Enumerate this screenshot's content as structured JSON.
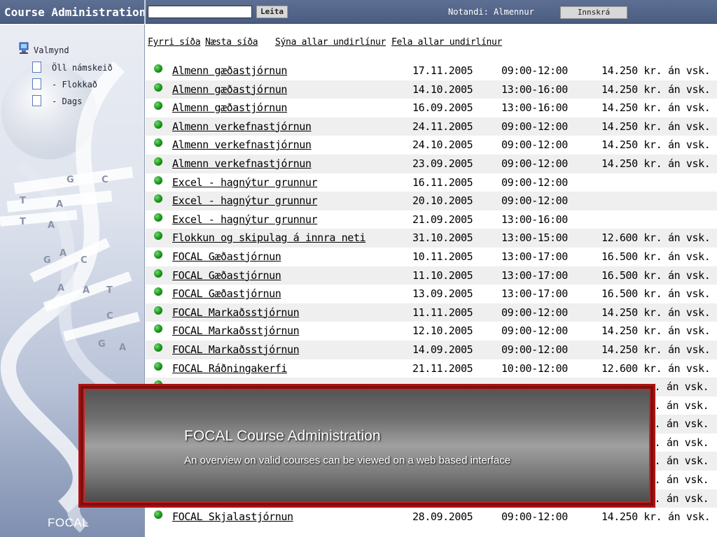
{
  "topbar": {
    "app_title": "Course Administration",
    "search_value": "",
    "search_button": "Leita",
    "user_label": "Notandi: Almennur",
    "login_button": "Innskrá"
  },
  "sidebar": {
    "root": "Valmynd",
    "items": [
      {
        "label": "Öll námskeið"
      },
      {
        "label": "- Flokkað"
      },
      {
        "label": "- Dags"
      }
    ],
    "footer": "FOCAL",
    "decoration_letters": [
      "G",
      "C",
      "T",
      "A",
      "T",
      "A",
      "A",
      "G",
      "C",
      "A",
      "A",
      "T",
      "C",
      "G",
      "A"
    ]
  },
  "nav": {
    "prev": "Fyrri síða",
    "next": "Næsta síða",
    "show_all": "Sýna allar undirlínur",
    "hide_all": "Fela allar undirlínur"
  },
  "courses": [
    {
      "name": "Almenn gæðastjórnun",
      "date": "17.11.2005",
      "time": "09:00-12:00",
      "price": "14.250 kr. án vsk."
    },
    {
      "name": "Almenn gæðastjórnun",
      "date": "14.10.2005",
      "time": "13:00-16:00",
      "price": "14.250 kr. án vsk."
    },
    {
      "name": "Almenn gæðastjórnun",
      "date": "16.09.2005",
      "time": "13:00-16:00",
      "price": "14.250 kr. án vsk."
    },
    {
      "name": "Almenn verkefnastjórnun",
      "date": "24.11.2005",
      "time": "09:00-12:00",
      "price": "14.250 kr. án vsk."
    },
    {
      "name": "Almenn verkefnastjórnun",
      "date": "24.10.2005",
      "time": "09:00-12:00",
      "price": "14.250 kr. án vsk."
    },
    {
      "name": "Almenn verkefnastjórnun",
      "date": "23.09.2005",
      "time": "09:00-12:00",
      "price": "14.250 kr. án vsk."
    },
    {
      "name": "Excel - hagnýtur grunnur",
      "date": "16.11.2005",
      "time": "09:00-12:00",
      "price": ""
    },
    {
      "name": "Excel - hagnýtur grunnur",
      "date": "20.10.2005",
      "time": "09:00-12:00",
      "price": ""
    },
    {
      "name": "Excel - hagnýtur grunnur",
      "date": "21.09.2005",
      "time": "13:00-16:00",
      "price": ""
    },
    {
      "name": "Flokkun og skipulag á innra neti",
      "date": "31.10.2005",
      "time": "13:00-15:00",
      "price": "12.600 kr. án vsk."
    },
    {
      "name": "FOCAL Gæðastjórnun",
      "date": "10.11.2005",
      "time": "13:00-17:00",
      "price": "16.500 kr. án vsk."
    },
    {
      "name": "FOCAL Gæðastjórnun",
      "date": "11.10.2005",
      "time": "13:00-17:00",
      "price": "16.500 kr. án vsk."
    },
    {
      "name": "FOCAL Gæðastjórnun",
      "date": "13.09.2005",
      "time": "13:00-17:00",
      "price": "16.500 kr. án vsk."
    },
    {
      "name": "FOCAL Markaðsstjórnun",
      "date": "11.11.2005",
      "time": "09:00-12:00",
      "price": "14.250 kr. án vsk."
    },
    {
      "name": "FOCAL Markaðsstjórnun",
      "date": "12.10.2005",
      "time": "09:00-12:00",
      "price": "14.250 kr. án vsk."
    },
    {
      "name": "FOCAL Markaðsstjórnun",
      "date": "14.09.2005",
      "time": "09:00-12:00",
      "price": "14.250 kr. án vsk."
    },
    {
      "name": "FOCAL Ráðningakerfi",
      "date": "21.11.2005",
      "time": "10:00-12:00",
      "price": "12.600 kr. án vsk."
    },
    {
      "name": "",
      "date": "",
      "time": "",
      "price": "r. án vsk."
    },
    {
      "name": "",
      "date": "",
      "time": "",
      "price": "r. án vsk."
    },
    {
      "name": "",
      "date": "",
      "time": "",
      "price": "r. án vsk."
    },
    {
      "name": "",
      "date": "",
      "time": "",
      "price": "r. án vsk."
    },
    {
      "name": "",
      "date": "",
      "time": "",
      "price": "r. án vsk."
    },
    {
      "name": "",
      "date": "",
      "time": "",
      "price": "r. án vsk."
    },
    {
      "name": "",
      "date": "",
      "time": "",
      "price": "r. án vsk."
    },
    {
      "name": "FOCAL Skjalastjórnun",
      "date": "28.09.2005",
      "time": "09:00-12:00",
      "price": "14.250 kr. án vsk."
    }
  ],
  "overlay": {
    "title": "FOCAL Course Administration",
    "subtitle": "An overview on valid courses can be viewed on a web based interface"
  },
  "colors": {
    "topbar": "#4a5c80",
    "bullet": "#1f9a1f",
    "overlay_border": "#b01010",
    "row_alt": "#efefef"
  }
}
